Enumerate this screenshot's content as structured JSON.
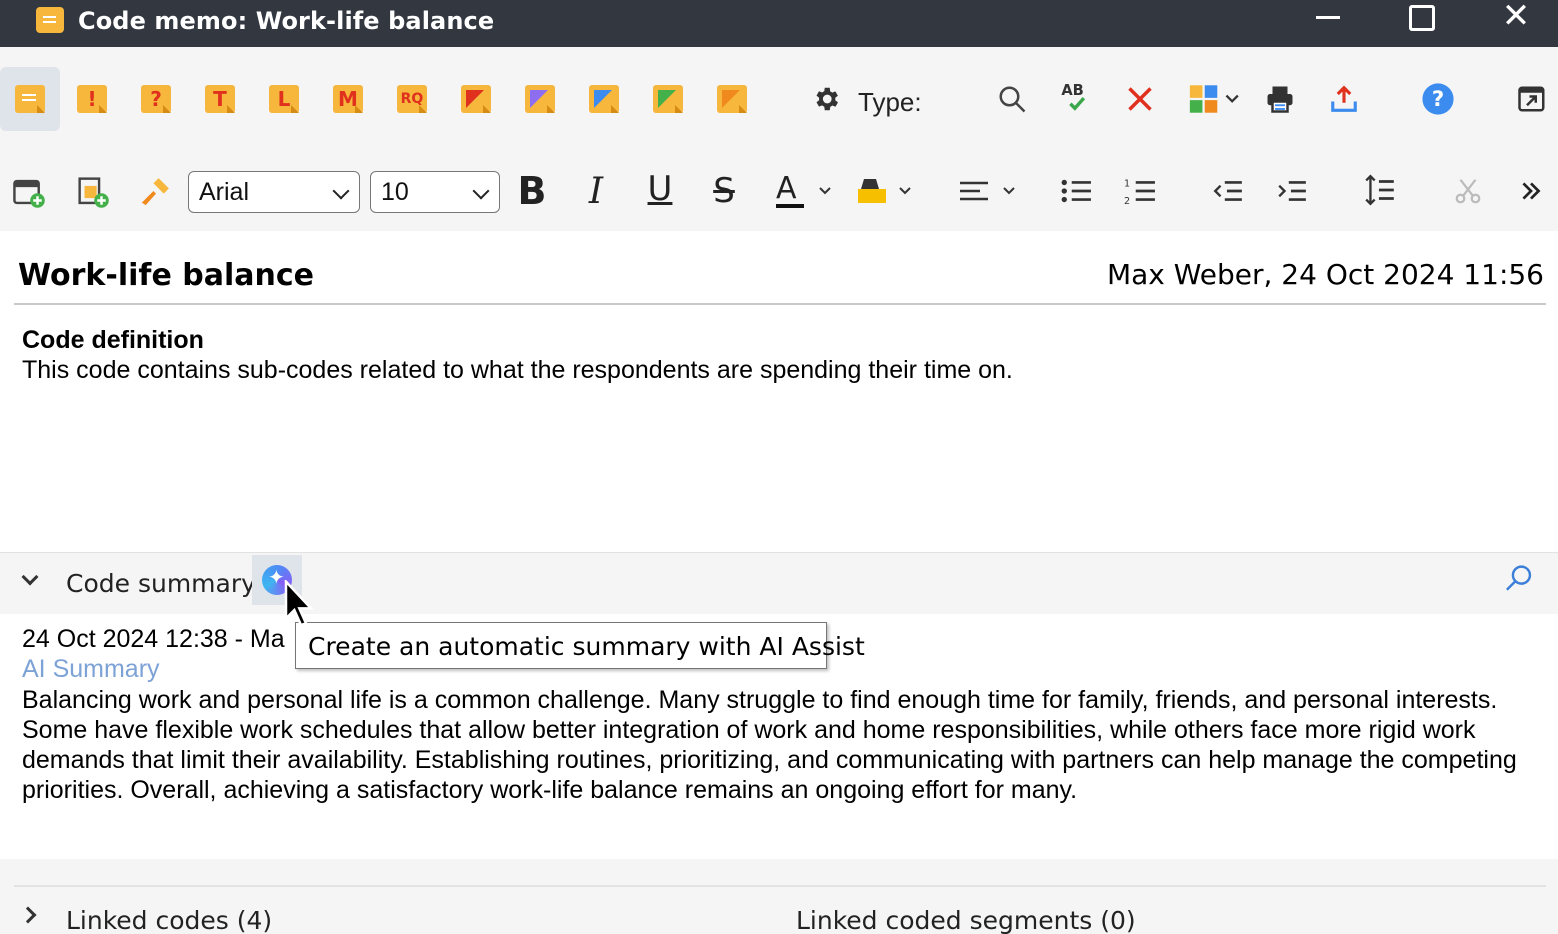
{
  "window": {
    "title": "Code memo: Work-life balance",
    "app_icon": "memo-icon",
    "controls": [
      "minimize-icon",
      "maximize-icon",
      "close-icon"
    ]
  },
  "toolbar1": {
    "memo_types": [
      {
        "name": "memo-default",
        "glyph": ""
      },
      {
        "name": "memo-exclamation",
        "glyph": "!"
      },
      {
        "name": "memo-question",
        "glyph": "?"
      },
      {
        "name": "memo-t",
        "glyph": "T"
      },
      {
        "name": "memo-l",
        "glyph": "L"
      },
      {
        "name": "memo-m",
        "glyph": "M"
      },
      {
        "name": "memo-rq",
        "glyph": "RQ"
      },
      {
        "name": "memo-red",
        "color": "#e0301e"
      },
      {
        "name": "memo-purple",
        "color": "#8d6ef0"
      },
      {
        "name": "memo-blue",
        "color": "#3c8cf0"
      },
      {
        "name": "memo-green",
        "color": "#44b04a"
      },
      {
        "name": "memo-orange",
        "color": "#f08a1e"
      }
    ],
    "type_label": "Type:",
    "icons": [
      "gear-icon",
      "search-icon",
      "spellcheck-icon",
      "delete-icon",
      "puzzle-icon",
      "print-icon",
      "export-icon",
      "help-icon",
      "open-external-icon"
    ]
  },
  "toolbar2": {
    "font_family": "Arial",
    "font_size": "10",
    "icons": [
      "insert-date-icon",
      "insert-link-icon",
      "format-painter-icon",
      "bold-icon",
      "italic-icon",
      "underline-icon",
      "strikethrough-icon",
      "font-color-icon",
      "highlight-icon",
      "align-icon",
      "bullet-list-icon",
      "numbered-list-icon",
      "outdent-icon",
      "indent-icon",
      "line-spacing-icon",
      "cut-icon",
      "more-icon"
    ],
    "bold_glyph": "B",
    "italic_glyph": "I",
    "underline_glyph": "U",
    "strike_glyph": "S",
    "font_color_glyph": "A"
  },
  "memo": {
    "title": "Work-life balance",
    "author_date": "Max Weber, 24 Oct 2024 11:56",
    "definition_heading": "Code definition",
    "definition_text": "This code contains sub-codes related to what the respondents are spending their time on."
  },
  "summary": {
    "label": "Code summary",
    "date_line": "24 Oct 2024 12:38 - Ma",
    "ai_label": "AI Summary",
    "text": "Balancing work and personal life is a common challenge. Many struggle to find enough time for family, friends, and personal interests. Some have flexible work schedules that allow better integration of work and home responsibilities, while others face more rigid work demands that limit their availability. Establishing routines, prioritizing, and communicating with partners can help manage the competing priorities. Overall, achieving a satisfactory work-life balance remains an ongoing effort for many."
  },
  "bottom": {
    "linked_codes": "Linked codes (4)",
    "linked_segments": "Linked coded segments (0)"
  },
  "tooltip": {
    "text": "Create an automatic summary with AI Assist"
  }
}
